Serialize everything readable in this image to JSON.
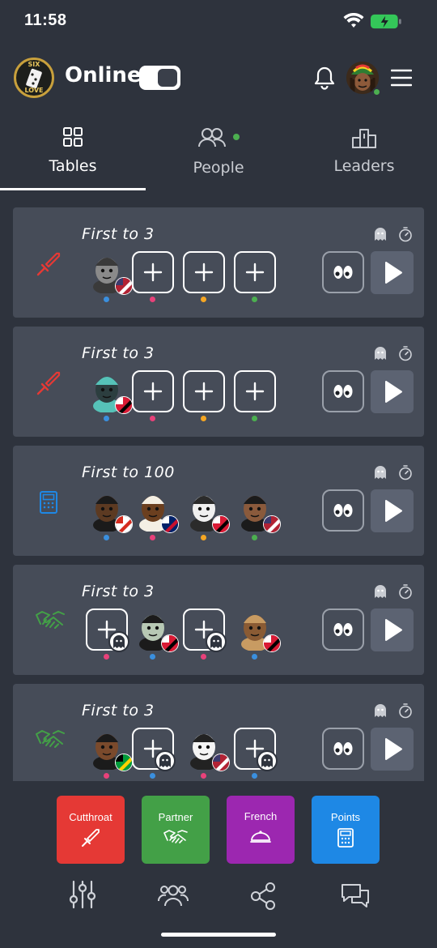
{
  "status": {
    "time": "11:58"
  },
  "header": {
    "logo_text_top": "SIX",
    "logo_text_bottom": "LOVE",
    "title": "Online",
    "toggle_on": true
  },
  "tabs": [
    {
      "label": "Tables",
      "icon": "grid-icon",
      "active": true
    },
    {
      "label": "People",
      "icon": "people-icon",
      "active": false,
      "online_indicator": true
    },
    {
      "label": "Leaders",
      "icon": "podium-icon",
      "active": false
    }
  ],
  "tables": [
    {
      "title": "First to 3",
      "mode": "cutthroat",
      "mode_icon": "sword-icon",
      "seats": [
        {
          "type": "player",
          "avatar": "raccoon-avatar",
          "flag": "us-flag",
          "dot": "#3a8fde"
        },
        {
          "type": "empty",
          "dot": "#e8417a"
        },
        {
          "type": "empty",
          "dot": "#f5a623"
        },
        {
          "type": "empty",
          "dot": "#4caf50"
        }
      ]
    },
    {
      "title": "First to 3",
      "mode": "cutthroat",
      "mode_icon": "sword-icon",
      "seats": [
        {
          "type": "player",
          "avatar": "spider-avatar",
          "flag": "tt-flag",
          "dot": "#3a8fde"
        },
        {
          "type": "empty",
          "dot": "#e8417a"
        },
        {
          "type": "empty",
          "dot": "#f5a623"
        },
        {
          "type": "empty",
          "dot": "#4caf50"
        }
      ]
    },
    {
      "title": "First to 100",
      "mode": "points",
      "mode_icon": "calculator-icon",
      "seats": [
        {
          "type": "player",
          "avatar": "afro-person-avatar",
          "flag": "ca-flag",
          "dot": "#3a8fde"
        },
        {
          "type": "player",
          "avatar": "coconut-avatar",
          "flag": "uk-flag",
          "dot": "#e8417a"
        },
        {
          "type": "player",
          "avatar": "husky-avatar",
          "flag": "tt-flag",
          "dot": "#f5a623"
        },
        {
          "type": "player",
          "avatar": "woman-avatar",
          "flag": "us-flag",
          "dot": "#4caf50"
        }
      ]
    },
    {
      "title": "First to 3",
      "mode": "partner",
      "mode_icon": "handshake-icon",
      "seats": [
        {
          "type": "empty-ghost",
          "dot": "#e8417a"
        },
        {
          "type": "player",
          "avatar": "zombie-avatar",
          "flag": "tt-flag",
          "dot": "#3a8fde"
        },
        {
          "type": "empty-ghost",
          "dot": "#e8417a"
        },
        {
          "type": "player",
          "avatar": "owl-avatar",
          "flag": "tt-flag",
          "dot": "#3a8fde"
        }
      ]
    },
    {
      "title": "First to 3",
      "mode": "partner",
      "mode_icon": "handshake-icon",
      "seats": [
        {
          "type": "player",
          "avatar": "man-avatar",
          "flag": "jm-flag",
          "dot": "#e8417a"
        },
        {
          "type": "empty-ghost",
          "dot": "#3a8fde"
        },
        {
          "type": "player",
          "avatar": "dog-avatar",
          "flag": "us-flag",
          "dot": "#e8417a"
        },
        {
          "type": "empty-ghost",
          "dot": "#3a8fde"
        }
      ]
    }
  ],
  "modes": [
    {
      "label": "Cutthroat",
      "color": "#e53935",
      "icon": "sword-icon"
    },
    {
      "label": "Partner",
      "color": "#43a047",
      "icon": "handshake-icon"
    },
    {
      "label": "French",
      "color": "#9c27b0",
      "icon": "dish-icon"
    },
    {
      "label": "Points",
      "color": "#1e88e5",
      "icon": "calculator-icon"
    }
  ],
  "bottom_nav": [
    {
      "icon": "sliders-icon"
    },
    {
      "icon": "group-icon"
    },
    {
      "icon": "share-icon"
    },
    {
      "icon": "chat-icon"
    }
  ],
  "colors": {
    "background": "#2e333d",
    "card": "#464c58",
    "cutthroat_icon": "#e53935",
    "partner_icon": "#43a047",
    "points_icon": "#1e88e5"
  }
}
